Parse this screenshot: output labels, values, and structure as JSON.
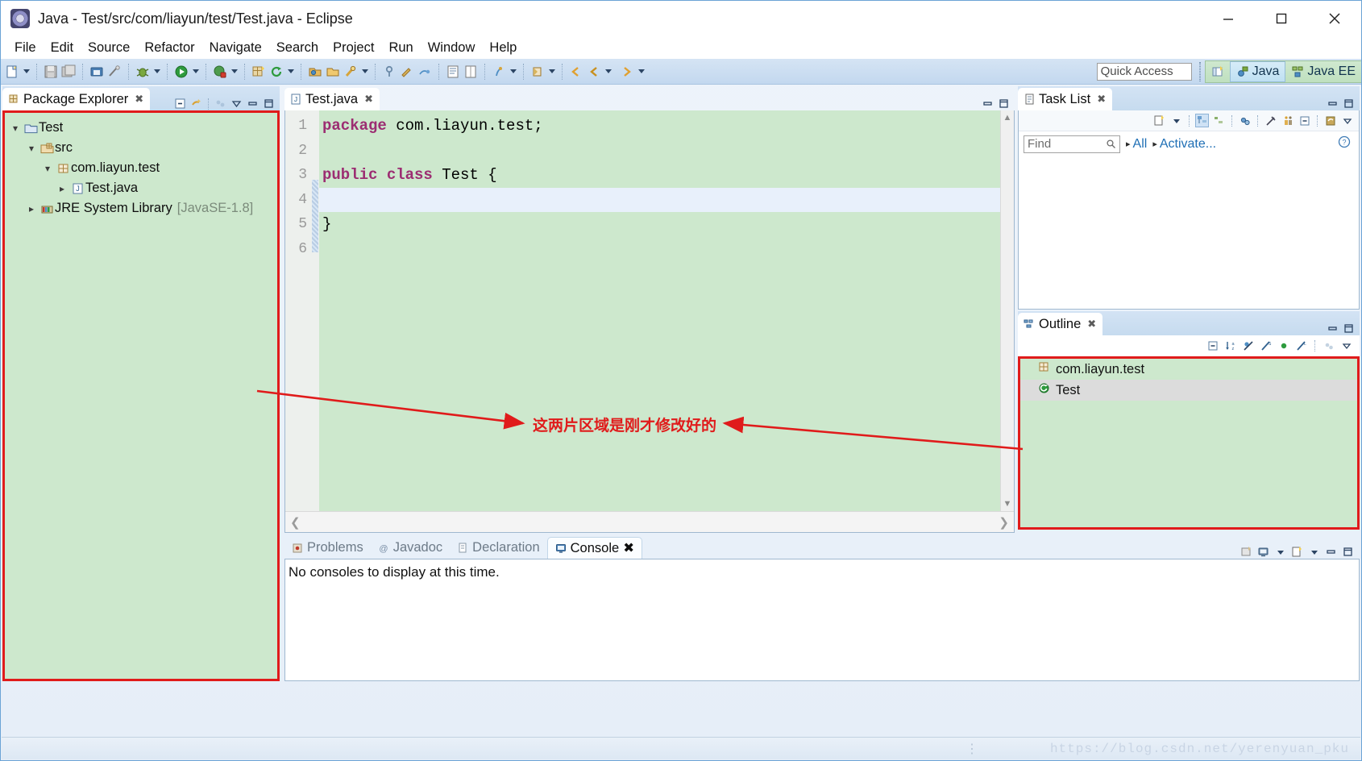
{
  "window": {
    "title": "Java - Test/src/com/liayun/test/Test.java - Eclipse",
    "app_icon": "eclipse-icon",
    "minimize_label": "Minimize",
    "maximize_label": "Maximize",
    "close_label": "Close"
  },
  "menubar": {
    "items": [
      {
        "label": "File"
      },
      {
        "label": "Edit"
      },
      {
        "label": "Source"
      },
      {
        "label": "Refactor"
      },
      {
        "label": "Navigate"
      },
      {
        "label": "Search"
      },
      {
        "label": "Project"
      },
      {
        "label": "Run"
      },
      {
        "label": "Window"
      },
      {
        "label": "Help"
      }
    ]
  },
  "toolbar": {
    "quick_access_placeholder": "Quick Access",
    "icons": [
      "new-wizard-icon",
      "save-icon",
      "save-all-icon",
      "print-icon",
      "toggle-mark-occurrences-icon",
      "debug-icon",
      "run-icon",
      "external-tools-icon",
      "new-java-package-icon",
      "refresh-icon",
      "open-type-icon",
      "open-task-icon",
      "search-icon",
      "pin-icon",
      "build-icon",
      "skip-breakpoints-icon",
      "console-view-icon",
      "table-icon",
      "annotation-icon",
      "previous-annotation-icon",
      "back-icon",
      "forward-icon"
    ],
    "perspectives": [
      {
        "label": "",
        "name": "open-perspective-icon"
      },
      {
        "label": "Java",
        "name": "perspective-java",
        "active": true
      },
      {
        "label": "Java EE",
        "name": "perspective-java-ee",
        "active": false
      }
    ]
  },
  "package_explorer": {
    "tab_label": "Package Explorer",
    "tab_icon": "package-explorer-icon",
    "tools": [
      "collapse-all-icon",
      "link-with-editor-icon",
      "view-menu-icon",
      "minimize-icon",
      "maximize-icon"
    ],
    "tree": [
      {
        "label": "Test",
        "icon": "java-project-icon",
        "indent": 0,
        "twisty": "expanded",
        "suffix": ""
      },
      {
        "label": "src",
        "icon": "source-folder-icon",
        "indent": 1,
        "twisty": "expanded",
        "suffix": ""
      },
      {
        "label": "com.liayun.test",
        "icon": "package-icon",
        "indent": 2,
        "twisty": "expanded",
        "suffix": ""
      },
      {
        "label": "Test.java",
        "icon": "java-file-icon",
        "indent": 3,
        "twisty": "collapsed",
        "suffix": ""
      },
      {
        "label": "JRE System Library",
        "icon": "library-icon",
        "indent": 2,
        "twisty": "collapsed",
        "suffix": "[JavaSE-1.8]"
      }
    ]
  },
  "editor": {
    "tab_label": "Test.java",
    "tab_icon": "java-file-icon",
    "tab_close": "✗",
    "lines": [
      {
        "no": "1",
        "segments": [
          {
            "text": "package",
            "kind": "keyword"
          },
          {
            "text": " com.liayun.test;",
            "kind": "plain"
          }
        ],
        "current": false
      },
      {
        "no": "2",
        "segments": [
          {
            "text": "",
            "kind": "plain"
          }
        ],
        "current": false
      },
      {
        "no": "3",
        "segments": [
          {
            "text": "public class",
            "kind": "keyword"
          },
          {
            "text": " Test {",
            "kind": "plain"
          }
        ],
        "current": false
      },
      {
        "no": "4",
        "segments": [
          {
            "text": "",
            "kind": "plain"
          }
        ],
        "current": true
      },
      {
        "no": "5",
        "segments": [
          {
            "text": "}",
            "kind": "plain"
          }
        ],
        "current": false
      },
      {
        "no": "6",
        "segments": [
          {
            "text": "",
            "kind": "plain"
          }
        ],
        "current": false
      }
    ]
  },
  "task_list": {
    "tab_label": "Task List",
    "tab_icon": "task-list-icon",
    "find_placeholder": "Find",
    "filter_all": "All",
    "filter_activate": "Activate...",
    "help_label": "?",
    "tools": [
      "new-task-icon",
      "categorize-icon",
      "schedule-icon",
      "focus-icon",
      "filter-icon",
      "working-set-icon",
      "collapse-all-icon",
      "synchronize-icon",
      "view-menu-icon"
    ]
  },
  "outline": {
    "tab_label": "Outline",
    "tab_icon": "outline-icon",
    "tools": [
      "collapse-all-icon",
      "sort-icon",
      "hide-fields-icon",
      "hide-static-icon",
      "hide-non-public-icon",
      "hide-local-icon",
      "link-icon",
      "view-menu-icon"
    ],
    "items": [
      {
        "label": "com.liayun.test",
        "icon": "package-icon",
        "selected": false
      },
      {
        "label": "Test",
        "icon": "class-icon",
        "selected": true
      }
    ]
  },
  "bottom_panel": {
    "tabs": [
      {
        "label": "Problems",
        "icon": "problems-icon",
        "active": false
      },
      {
        "label": "Javadoc",
        "icon": "javadoc-icon",
        "active": false
      },
      {
        "label": "Declaration",
        "icon": "declaration-icon",
        "active": false
      },
      {
        "label": "Console",
        "icon": "console-icon",
        "active": true
      }
    ],
    "console_message": "No consoles to display at this time.",
    "tools": [
      "open-console-icon",
      "display-selected-console-icon",
      "console-dropdown-icon",
      "new-console-view-icon",
      "new-console-dropdown-icon",
      "minimize-icon",
      "maximize-icon"
    ]
  },
  "annotation": {
    "text": "这两片区域是刚才修改好的",
    "color": "#e01b1b"
  },
  "status_bar": {
    "watermark": "https://blog.csdn.net/yerenyuan_pku",
    "dots": "⋮"
  },
  "colors": {
    "editor_background": "#cde8cd",
    "annotation_red": "#e01b1b",
    "keyword_purple": "#9c2d72",
    "link_blue": "#1f6fb5"
  }
}
